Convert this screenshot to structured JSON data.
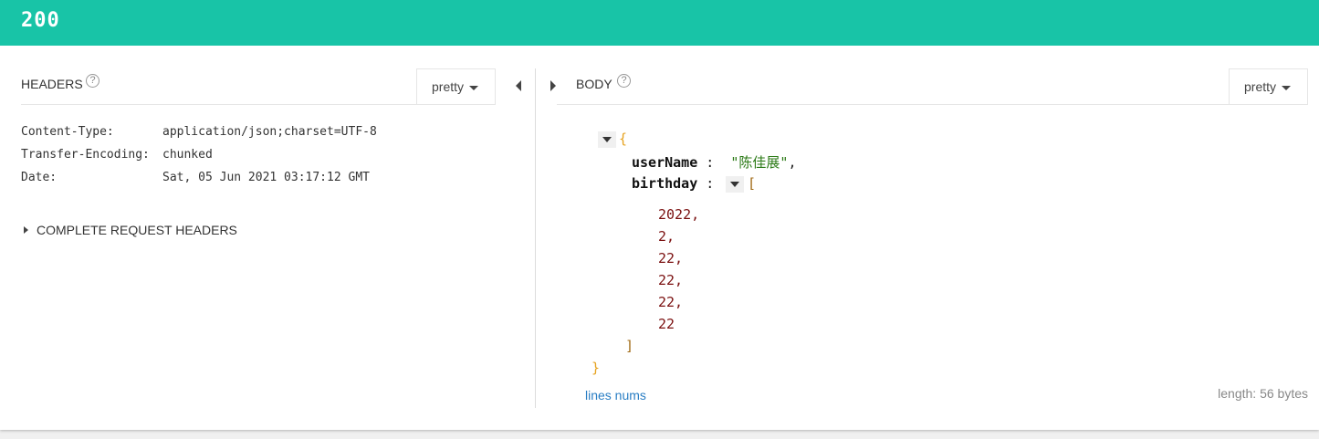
{
  "status": {
    "code": "200",
    "color": "#18c4a7"
  },
  "headers_pane": {
    "title": "HEADERS",
    "format": "pretty",
    "rows": [
      {
        "key": "Content-Type:",
        "value": "application/json;charset=UTF-8"
      },
      {
        "key": "Transfer-Encoding:",
        "value": "chunked"
      },
      {
        "key": "Date:",
        "value": "Sat, 05 Jun 2021 03:17:12 GMT"
      }
    ],
    "complete_label": "COMPLETE REQUEST HEADERS"
  },
  "body_pane": {
    "title": "BODY",
    "format": "pretty",
    "json": {
      "open_brace": "{",
      "close_brace": "}",
      "fields": {
        "username_key": "userName",
        "username_value": "\"陈佳展\"",
        "birthday_key": "birthday",
        "open_bracket": "[",
        "close_bracket": "]",
        "birthday_values": [
          "2022,",
          "2,",
          "22,",
          "22,",
          "22,",
          "22"
        ]
      },
      "colon": ":",
      "comma": ","
    },
    "lines_nums_label": "lines nums",
    "length_label": "length: 56 bytes"
  },
  "icons": {
    "help": "help-circle-icon",
    "collapse": "caret-left-icon",
    "expand": "caret-right-icon"
  }
}
